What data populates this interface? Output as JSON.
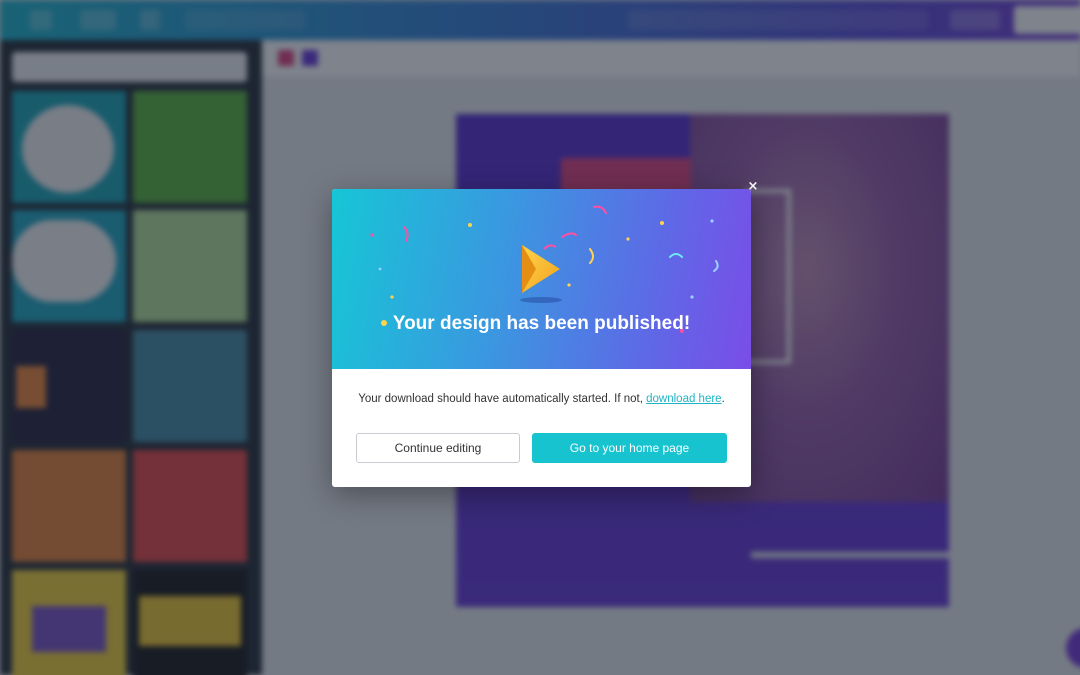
{
  "modal": {
    "title": "Your design has been published!",
    "message_prefix": "Your download should have automatically started. If not, ",
    "download_link": "download here",
    "message_suffix": ".",
    "continue_label": "Continue editing",
    "home_label": "Go to your home page",
    "close_symbol": "×",
    "close_icon": "close-icon",
    "hero_icon": "canva-play-icon"
  },
  "colors": {
    "primary_button": "#17c3cf",
    "link": "#1fb4c4",
    "hero_gradient_start": "#16c6d6",
    "hero_gradient_end": "#7a4de8",
    "topbar_start": "#1fb8cd",
    "topbar_end": "#7a3fd8",
    "sidebar_bg": "#293039"
  },
  "toolbar": {
    "swatches": [
      "#e0447f",
      "#6a3ad8"
    ]
  }
}
